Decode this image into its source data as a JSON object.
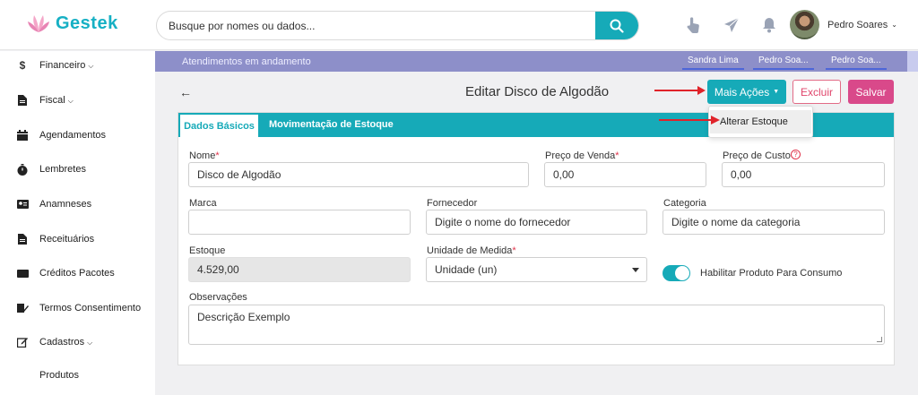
{
  "brand": {
    "name": "Gestek",
    "accent": "#16aab8"
  },
  "search": {
    "placeholder": "Busque por nomes ou dados..."
  },
  "user": {
    "name": "Pedro Soares"
  },
  "sidebar": {
    "items": [
      {
        "label": "Financeiro",
        "icon": "dollar-icon",
        "has_chevron": true
      },
      {
        "label": "Fiscal",
        "icon": "document-icon",
        "has_chevron": true
      },
      {
        "label": "Agendamentos",
        "icon": "calendar-icon"
      },
      {
        "label": "Lembretes",
        "icon": "stopwatch-icon"
      },
      {
        "label": "Anamneses",
        "icon": "id-card-icon"
      },
      {
        "label": "Receituários",
        "icon": "file-icon"
      },
      {
        "label": "Créditos Pacotes",
        "icon": "ticket-icon"
      },
      {
        "label": "Termos Consentimento",
        "icon": "signature-icon"
      },
      {
        "label": "Cadastros",
        "icon": "edit-icon",
        "has_chevron": true
      },
      {
        "label": "Produtos",
        "icon": ""
      }
    ]
  },
  "attendances": {
    "title": "Atendimentos em andamento",
    "tabs": [
      "Sandra Lima",
      "Pedro Soa...",
      "Pedro Soa..."
    ]
  },
  "page": {
    "title": "Editar Disco de Algodão",
    "more_actions": "Mais Ações",
    "delete": "Excluir",
    "save": "Salvar"
  },
  "dropdown": {
    "items": [
      "Alterar Estoque"
    ]
  },
  "tabs": {
    "active": "Dados Básicos",
    "other": "Movimentação de Estoque"
  },
  "form": {
    "nome": {
      "label": "Nome",
      "value": "Disco de Algodão"
    },
    "preco_venda": {
      "label": "Preço de Venda",
      "value": "0,00"
    },
    "preco_custo": {
      "label": "Preço de Custo",
      "value": "0,00"
    },
    "marca": {
      "label": "Marca",
      "value": ""
    },
    "fornecedor": {
      "label": "Fornecedor",
      "placeholder": "Digite o nome do fornecedor"
    },
    "categoria": {
      "label": "Categoria",
      "placeholder": "Digite o nome da categoria"
    },
    "estoque": {
      "label": "Estoque",
      "value": "4.529,00"
    },
    "unidade": {
      "label": "Unidade de Medida",
      "value": "Unidade (un)"
    },
    "habilitar": {
      "label": "Habilitar Produto Para Consumo",
      "enabled": true
    },
    "observacoes": {
      "label": "Observações",
      "value": "Descrição Exemplo"
    }
  }
}
